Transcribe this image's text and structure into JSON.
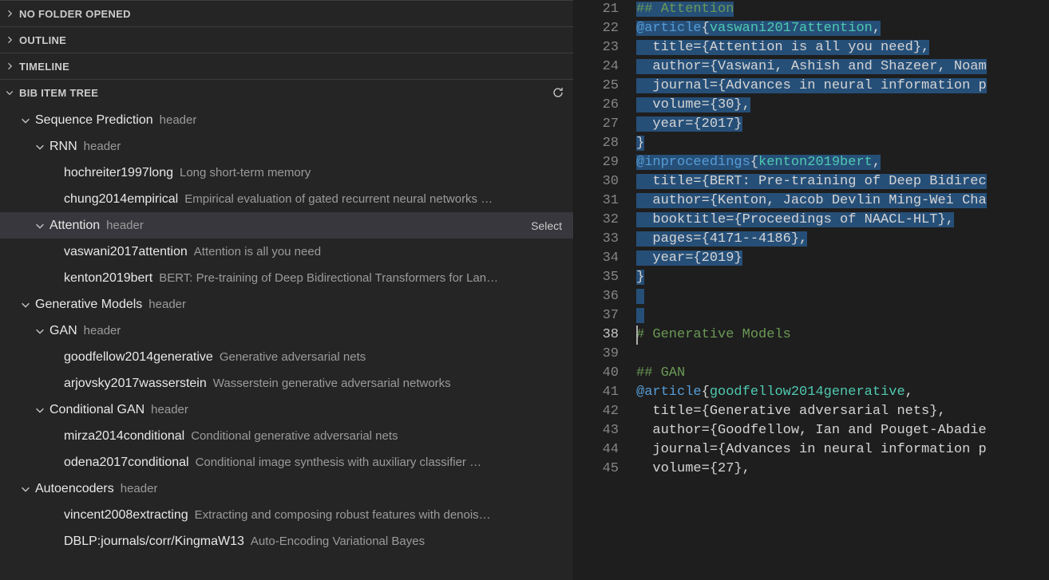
{
  "panels": {
    "no_folder": {
      "label": "NO FOLDER OPENED"
    },
    "outline": {
      "label": "OUTLINE"
    },
    "timeline": {
      "label": "TIMELINE"
    },
    "bib": {
      "label": "BIB ITEM TREE",
      "refresh_tooltip": "Refresh"
    }
  },
  "row_action": {
    "select_label": "Select"
  },
  "tree": [
    {
      "depth": 1,
      "chev": "down",
      "key": "Sequence Prediction",
      "desc": "header"
    },
    {
      "depth": 2,
      "chev": "down",
      "key": "RNN",
      "desc": "header"
    },
    {
      "depth": 3,
      "chev": "",
      "key": "hochreiter1997long",
      "desc": "Long short-term memory"
    },
    {
      "depth": 3,
      "chev": "",
      "key": "chung2014empirical",
      "desc": "Empirical evaluation of gated recurrent neural networks …"
    },
    {
      "depth": 2,
      "chev": "down",
      "key": "Attention",
      "desc": "header",
      "hovered": true,
      "action": "select"
    },
    {
      "depth": 3,
      "chev": "",
      "key": "vaswani2017attention",
      "desc": "Attention is all you need"
    },
    {
      "depth": 3,
      "chev": "",
      "key": "kenton2019bert",
      "desc": "BERT: Pre-training of Deep Bidirectional Transformers for Lan…"
    },
    {
      "depth": 1,
      "chev": "down",
      "key": "Generative Models",
      "desc": "header"
    },
    {
      "depth": 2,
      "chev": "down",
      "key": "GAN",
      "desc": "header"
    },
    {
      "depth": 3,
      "chev": "",
      "key": "goodfellow2014generative",
      "desc": "Generative adversarial nets"
    },
    {
      "depth": 3,
      "chev": "",
      "key": "arjovsky2017wasserstein",
      "desc": "Wasserstein generative adversarial networks"
    },
    {
      "depth": 2,
      "chev": "down",
      "key": "Conditional GAN",
      "desc": "header"
    },
    {
      "depth": 3,
      "chev": "",
      "key": "mirza2014conditional",
      "desc": "Conditional generative adversarial nets"
    },
    {
      "depth": 3,
      "chev": "",
      "key": "odena2017conditional",
      "desc": "Conditional image synthesis with auxiliary classifier …"
    },
    {
      "depth": 1,
      "chev": "down",
      "key": "Autoencoders",
      "desc": "header"
    },
    {
      "depth": 3,
      "chev": "",
      "key": "vincent2008extracting",
      "desc": "Extracting and composing robust features with denois…"
    },
    {
      "depth": 3,
      "chev": "",
      "key": "DBLP:journals/corr/KingmaW13",
      "desc": "Auto-Encoding Variational Bayes"
    }
  ],
  "editor": {
    "first_line_no": 21,
    "active_line_no": 38,
    "lines": [
      {
        "sel": true,
        "tokens": [
          {
            "c": "comment",
            "t": "## Attention"
          }
        ]
      },
      {
        "sel": true,
        "tokens": [
          {
            "c": "keyword",
            "t": "@article"
          },
          {
            "c": "brace",
            "t": "{"
          },
          {
            "c": "citekey",
            "t": "vaswani2017attention"
          },
          {
            "c": "punct",
            "t": ","
          }
        ]
      },
      {
        "sel": true,
        "tokens": [
          {
            "c": "field",
            "t": "  title={Attention is all you need},"
          }
        ]
      },
      {
        "sel": true,
        "tokens": [
          {
            "c": "field",
            "t": "  author={Vaswani, Ashish and Shazeer, Noam"
          }
        ]
      },
      {
        "sel": true,
        "tokens": [
          {
            "c": "field",
            "t": "  journal={Advances in neural information p"
          }
        ]
      },
      {
        "sel": true,
        "tokens": [
          {
            "c": "field",
            "t": "  volume={30},"
          }
        ]
      },
      {
        "sel": true,
        "tokens": [
          {
            "c": "field",
            "t": "  year={2017}"
          }
        ]
      },
      {
        "sel": true,
        "tokens": [
          {
            "c": "brace",
            "t": "}"
          }
        ]
      },
      {
        "sel": true,
        "tokens": [
          {
            "c": "keyword",
            "t": "@inproceedings"
          },
          {
            "c": "brace",
            "t": "{"
          },
          {
            "c": "citekey",
            "t": "kenton2019bert"
          },
          {
            "c": "punct",
            "t": ","
          }
        ]
      },
      {
        "sel": true,
        "tokens": [
          {
            "c": "field",
            "t": "  title={BERT: Pre-training of Deep Bidirec"
          }
        ]
      },
      {
        "sel": true,
        "tokens": [
          {
            "c": "field",
            "t": "  author={Kenton, Jacob Devlin Ming-Wei Cha"
          }
        ]
      },
      {
        "sel": true,
        "tokens": [
          {
            "c": "field",
            "t": "  booktitle={Proceedings of NAACL-HLT},"
          }
        ]
      },
      {
        "sel": true,
        "tokens": [
          {
            "c": "field",
            "t": "  pages={4171--4186},"
          }
        ]
      },
      {
        "sel": true,
        "tokens": [
          {
            "c": "field",
            "t": "  year={2019}"
          }
        ]
      },
      {
        "sel": true,
        "tokens": [
          {
            "c": "brace",
            "t": "}"
          }
        ]
      },
      {
        "sel": true,
        "tokens": [
          {
            "c": "field",
            "t": ""
          }
        ]
      },
      {
        "sel": true,
        "tokens": [
          {
            "c": "field",
            "t": ""
          }
        ]
      },
      {
        "sel": false,
        "caret": true,
        "tokens": [
          {
            "c": "comment",
            "t": "# Generative Models"
          }
        ]
      },
      {
        "sel": false,
        "tokens": [
          {
            "c": "field",
            "t": ""
          }
        ]
      },
      {
        "sel": false,
        "tokens": [
          {
            "c": "comment",
            "t": "## GAN"
          }
        ]
      },
      {
        "sel": false,
        "tokens": [
          {
            "c": "keyword",
            "t": "@article"
          },
          {
            "c": "brace",
            "t": "{"
          },
          {
            "c": "citekey",
            "t": "goodfellow2014generative"
          },
          {
            "c": "punct",
            "t": ","
          }
        ]
      },
      {
        "sel": false,
        "tokens": [
          {
            "c": "field",
            "t": "  title={Generative adversarial nets},"
          }
        ]
      },
      {
        "sel": false,
        "tokens": [
          {
            "c": "field",
            "t": "  author={Goodfellow, Ian and Pouget-Abadie"
          }
        ]
      },
      {
        "sel": false,
        "tokens": [
          {
            "c": "field",
            "t": "  journal={Advances in neural information p"
          }
        ]
      },
      {
        "sel": false,
        "tokens": [
          {
            "c": "field",
            "t": "  volume={27},"
          }
        ]
      }
    ]
  }
}
